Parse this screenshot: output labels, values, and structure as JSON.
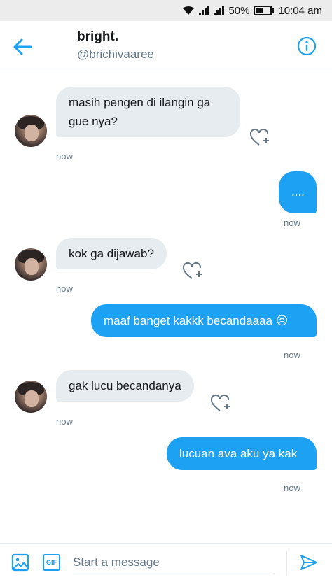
{
  "status_bar": {
    "battery": "50%",
    "time": "10:04 am",
    "battery_level": 0.5
  },
  "header": {
    "name": "bright.",
    "handle": "@brichivaaree"
  },
  "messages": [
    {
      "side": "in",
      "text": "masih pengen di ilangin ga gue nya?",
      "time": "now"
    },
    {
      "side": "out",
      "text": "....",
      "time": "now"
    },
    {
      "side": "in",
      "text": "kok ga dijawab?",
      "time": "now"
    },
    {
      "side": "out",
      "text": "maaf banget kakkk becandaaaa 😣",
      "time": "now"
    },
    {
      "side": "in",
      "text": "gak lucu becandanya",
      "time": "now"
    },
    {
      "side": "out",
      "text": "lucuan ava aku ya kak",
      "time": "now"
    }
  ],
  "composer": {
    "placeholder": "Start a message",
    "gif_label": "GIF"
  },
  "colors": {
    "accent": "#1da1f2",
    "incoming_bubble": "#e6ecf0",
    "secondary_text": "#657786"
  },
  "icons": [
    "wifi-icon",
    "signal-icon",
    "battery-icon",
    "back-arrow-icon",
    "info-icon",
    "heart-plus-icon",
    "image-icon",
    "gif-icon",
    "send-icon"
  ]
}
